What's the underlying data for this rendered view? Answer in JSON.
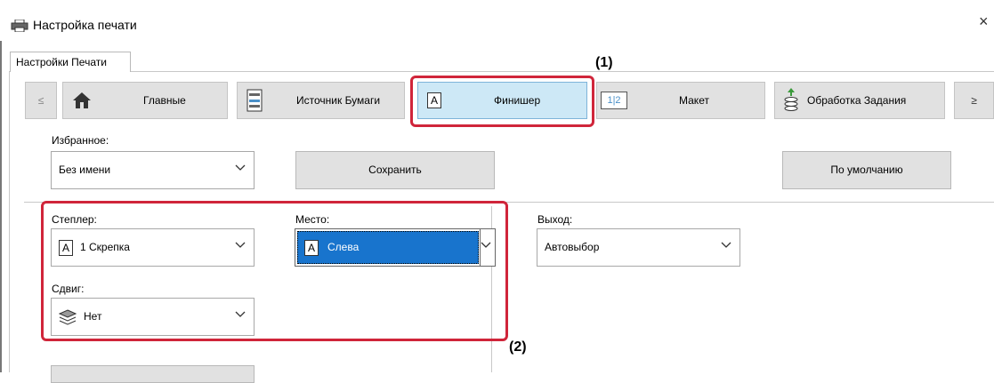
{
  "window": {
    "title": "Настройка печати",
    "close_glyph": "×"
  },
  "outer_tab": {
    "label": "Настройки Печати"
  },
  "tabs": {
    "prev_label": "≤",
    "next_label": "≥",
    "items": [
      {
        "label": "Главные",
        "icon": "home-icon"
      },
      {
        "label": "Источник Бумаги",
        "icon": "paper-tray-icon"
      },
      {
        "label": "Финишер",
        "icon": "finisher-icon",
        "active": true
      },
      {
        "label": "Макет",
        "icon": "layout-icon",
        "icon_text": "1|2"
      },
      {
        "label": "Обработка Задания",
        "icon": "job-handling-icon"
      }
    ]
  },
  "callouts": {
    "one": "(1)",
    "two": "(2)"
  },
  "favorites": {
    "label": "Избранное:",
    "value": "Без имени",
    "save_label": "Сохранить",
    "default_label": "По умолчанию"
  },
  "stapler": {
    "label": "Степлер:",
    "value": "1 Скрепка",
    "icon_text": "A"
  },
  "position": {
    "label": "Место:",
    "value": "Слева",
    "icon_text": "A"
  },
  "output": {
    "label": "Выход:",
    "value": "Автовыбор"
  },
  "offset": {
    "label": "Сдвиг:",
    "value": "Нет"
  },
  "colors": {
    "accent_red": "#d0253a",
    "selection_blue": "#1874cd",
    "active_tab": "#cde8f6"
  }
}
